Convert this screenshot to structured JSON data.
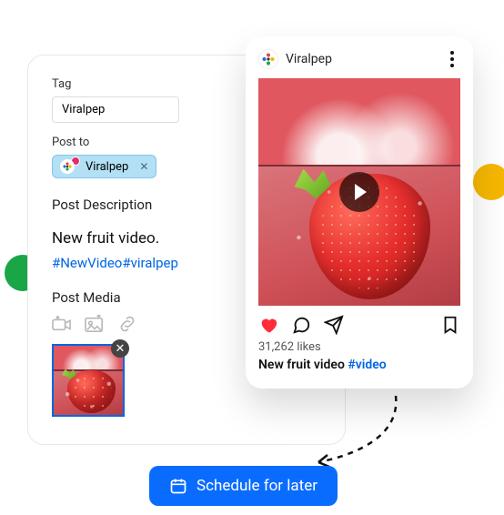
{
  "form": {
    "tag_label": "Tag",
    "tag_value": "Viralpep",
    "post_to_label": "Post to",
    "post_to_account": "Viralpep",
    "section_desc": "Post Description",
    "desc_text": "New fruit video.",
    "hashtags": "#NewVideo#viralpep",
    "section_media": "Post Media"
  },
  "preview": {
    "account": "Viralpep",
    "likes": "31,262 likes",
    "caption_text": "New fruit video ",
    "caption_tag": "#video"
  },
  "button": {
    "schedule": "Schedule for later"
  }
}
